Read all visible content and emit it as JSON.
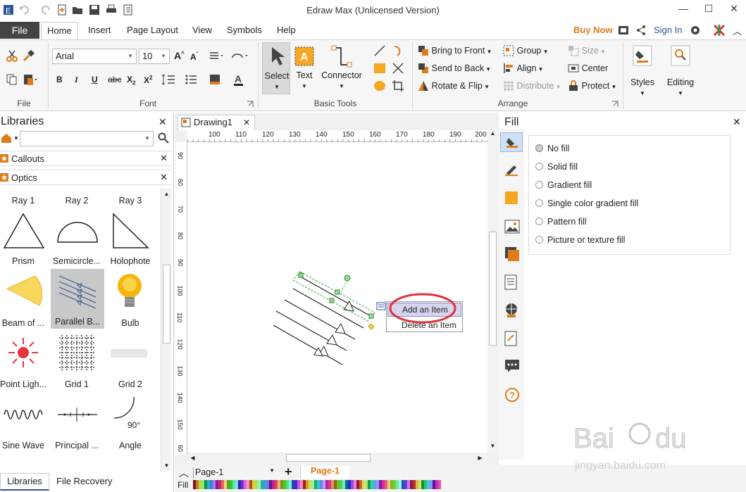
{
  "app": {
    "title": "Edraw Max (Unlicensed Version)"
  },
  "menu": {
    "file": "File",
    "tabs": [
      "Home",
      "Insert",
      "Page Layout",
      "View",
      "Symbols",
      "Help"
    ],
    "buy_now": "Buy Now",
    "sign_in": "Sign In"
  },
  "ribbon": {
    "font_name": "Arial",
    "font_size": "10",
    "groups": {
      "file": "File",
      "font": "Font",
      "basic_tools": "Basic Tools",
      "arrange": "Arrange"
    },
    "basic_tools": {
      "select": "Select",
      "text": "Text",
      "connector": "Connector"
    },
    "arrange": {
      "bring_to_front": "Bring to Front",
      "send_to_back": "Send to Back",
      "rotate_flip": "Rotate & Flip",
      "group": "Group",
      "align": "Align",
      "distribute": "Distribute",
      "size": "Size",
      "center": "Center",
      "protect": "Protect"
    },
    "styles": "Styles",
    "editing": "Editing"
  },
  "libraries": {
    "title": "Libraries",
    "sections": [
      "Callouts",
      "Optics"
    ],
    "shapes": [
      [
        "Ray 1",
        "Ray 2",
        "Ray 3"
      ],
      [
        "Prism",
        "Semicircle...",
        "Holophote"
      ],
      [
        "Beam of ...",
        "Parallel B...",
        "Bulb"
      ],
      [
        "Point Ligh...",
        "Grid 1",
        "Grid 2"
      ],
      [
        "Sine Wave",
        "Principal ...",
        "Angle"
      ]
    ],
    "angle_value": "90°",
    "bottom_tabs": [
      "Libraries",
      "File Recovery"
    ]
  },
  "document": {
    "tab": "Drawing1",
    "ruler_h": [
      "100",
      "110",
      "120",
      "130",
      "140",
      "150",
      "160",
      "170",
      "180",
      "190",
      "200"
    ],
    "ruler_v": [
      "90",
      "60",
      "70",
      "80",
      "90",
      "100",
      "110",
      "120",
      "130",
      "140",
      "150",
      "60"
    ]
  },
  "context_menu": {
    "add": "Add an Item",
    "delete": "Delete an Item"
  },
  "fill_panel": {
    "title": "Fill",
    "options": [
      "No fill",
      "Solid fill",
      "Gradient fill",
      "Single color gradient fill",
      "Pattern fill",
      "Picture or texture fill"
    ],
    "selected": "No fill"
  },
  "pages": {
    "selector": "Page-1",
    "active": "Page-1",
    "fill_label": "Fill"
  },
  "colors": {
    "accent": "#e07b1a",
    "file_tab": "#444444",
    "shape_orange": "#f5a623",
    "highlight_circle": "#e0303a"
  }
}
